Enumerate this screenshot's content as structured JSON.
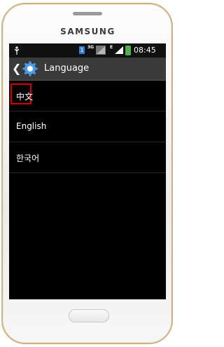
{
  "device": {
    "brand": "SAMSUNG"
  },
  "status_bar": {
    "icons": [
      "usb-icon",
      "sim-icon",
      "network-3g-icon",
      "signal-icon",
      "network-e-icon",
      "signal-bars-icon",
      "battery-icon"
    ],
    "sim_label": "1",
    "network_3g": "3G",
    "network_e": "E",
    "time": "08:45"
  },
  "action_bar": {
    "title": "Language",
    "icons": [
      "back-chevron-icon",
      "gear-icon"
    ]
  },
  "languages": [
    {
      "label": "中文",
      "highlighted": true
    },
    {
      "label": "English",
      "highlighted": false
    },
    {
      "label": "한국어",
      "highlighted": false
    }
  ],
  "colors": {
    "highlight": "#d40000",
    "screen": "#000000",
    "frame_trim": "#c9b489"
  }
}
